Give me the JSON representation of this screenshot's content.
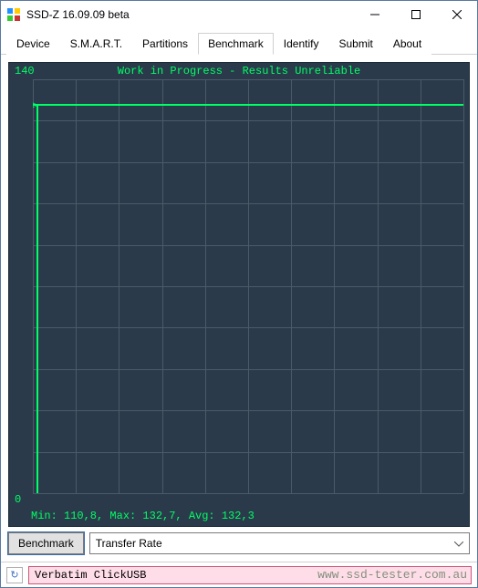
{
  "window": {
    "title": "SSD-Z 16.09.09 beta"
  },
  "tabs": {
    "items": [
      {
        "label": "Device"
      },
      {
        "label": "S.M.A.R.T."
      },
      {
        "label": "Partitions"
      },
      {
        "label": "Benchmark"
      },
      {
        "label": "Identify"
      },
      {
        "label": "Submit"
      },
      {
        "label": "About"
      }
    ],
    "active_index": 3
  },
  "chart_data": {
    "type": "line",
    "title": "Work in Progress - Results Unreliable",
    "ylabel": "",
    "xlabel": "",
    "ylim": [
      0,
      140
    ],
    "y_ticks": [
      0,
      140
    ],
    "series": [
      {
        "name": "Transfer Rate",
        "values_approx_constant": 132,
        "unit": "MB/s"
      }
    ],
    "stats": {
      "min": "110,8",
      "max": "132,7",
      "avg": "132,3"
    },
    "stats_text": "Min: 110,8, Max: 132,7, Avg: 132,3"
  },
  "controls": {
    "benchmark_button": "Benchmark",
    "mode_dropdown": {
      "selected": "Transfer Rate"
    }
  },
  "statusbar": {
    "device_name": "Verbatim ClickUSB",
    "watermark": "www.ssd-tester.com.au",
    "refresh_icon": "↻"
  }
}
